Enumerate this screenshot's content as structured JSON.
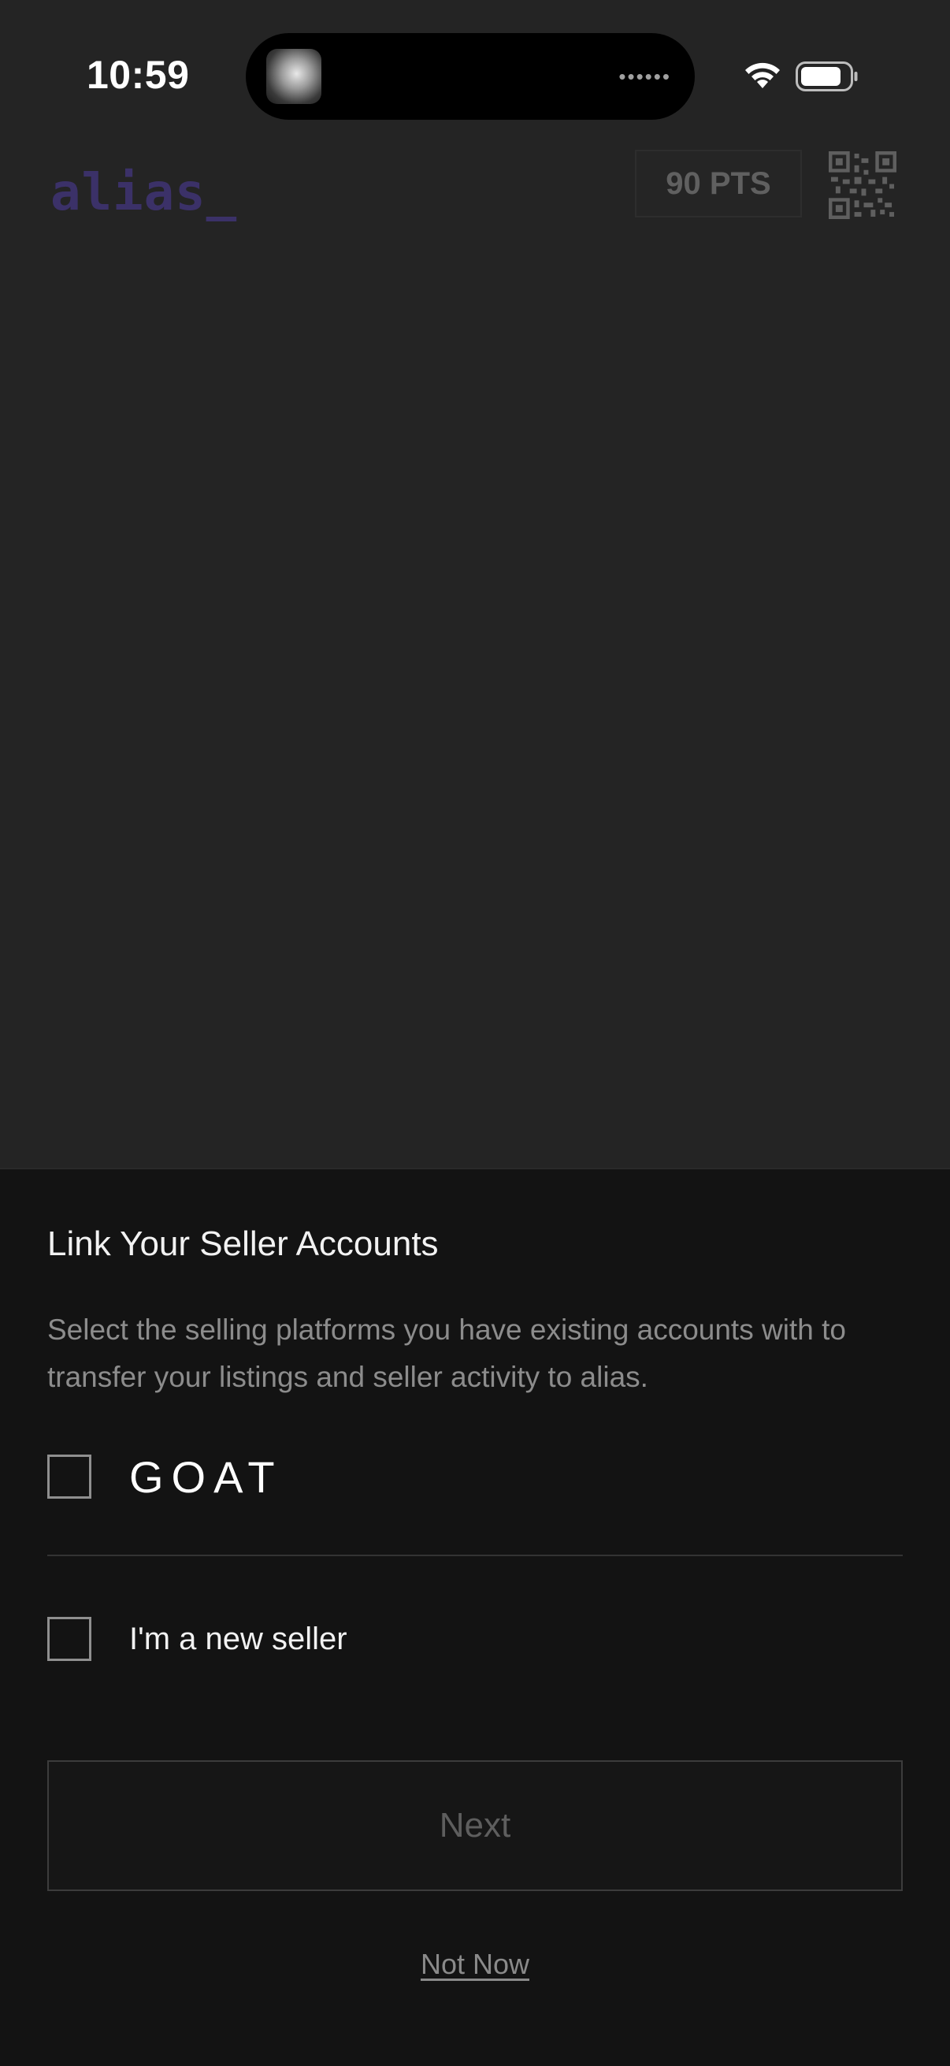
{
  "status_bar": {
    "time": "10:59",
    "island_indicator": "••••••",
    "icons": [
      "wifi-icon",
      "battery-icon"
    ]
  },
  "header": {
    "logo_text": "alias_",
    "points_label": "90 PTS",
    "qr_icon": "qr-code-icon"
  },
  "colors": {
    "brand": "#5f4fa8",
    "sheet_background": "#131313",
    "screen_background": "#3a3a3a"
  },
  "sheet": {
    "title": "Link Your Seller Accounts",
    "description": "Select the selling platforms you have existing accounts with to transfer your listings and seller activity to alias.",
    "options": [
      {
        "label": "GOAT",
        "checked": false
      },
      {
        "label": "I'm a new seller",
        "checked": false
      }
    ],
    "next_label": "Next",
    "not_now_label": "Not Now"
  }
}
